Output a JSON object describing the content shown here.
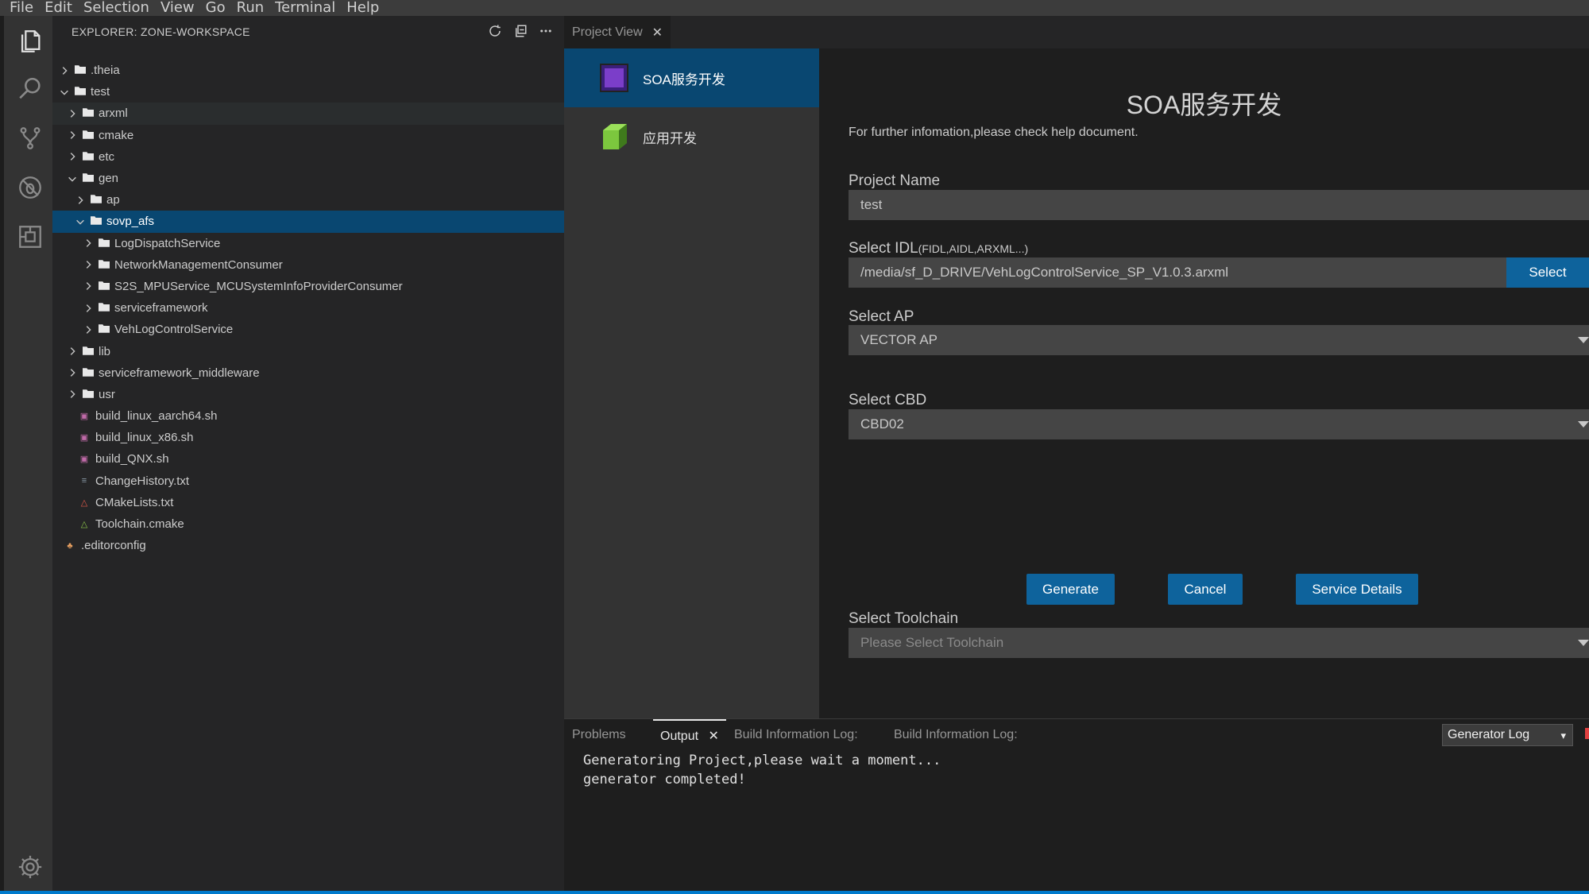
{
  "menu": [
    "File",
    "Edit",
    "Selection",
    "View",
    "Go",
    "Run",
    "Terminal",
    "Help"
  ],
  "activity_icons": [
    "files-icon",
    "search-icon",
    "source-control-icon",
    "debug-icon",
    "extensions-icon",
    "gear-icon"
  ],
  "explorer": {
    "title": "EXPLORER: ZONE-WORKSPACE",
    "tree": [
      {
        "label": ".theia",
        "depth": 0,
        "type": "folder",
        "expanded": false
      },
      {
        "label": "test",
        "depth": 0,
        "type": "folder",
        "expanded": true
      },
      {
        "label": "arxml",
        "depth": 1,
        "type": "folder",
        "expanded": false
      },
      {
        "label": "cmake",
        "depth": 1,
        "type": "folder",
        "expanded": false
      },
      {
        "label": "etc",
        "depth": 1,
        "type": "folder",
        "expanded": false
      },
      {
        "label": "gen",
        "depth": 1,
        "type": "folder",
        "expanded": true
      },
      {
        "label": "ap",
        "depth": 2,
        "type": "folder",
        "expanded": false
      },
      {
        "label": "sovp_afs",
        "depth": 2,
        "type": "folder",
        "expanded": true,
        "selected": true
      },
      {
        "label": "LogDispatchService",
        "depth": 3,
        "type": "folder",
        "expanded": false
      },
      {
        "label": "NetworkManagementConsumer",
        "depth": 3,
        "type": "folder",
        "expanded": false
      },
      {
        "label": "S2S_MPUService_MCUSystemInfoProviderConsumer",
        "depth": 3,
        "type": "folder",
        "expanded": false
      },
      {
        "label": "serviceframework",
        "depth": 3,
        "type": "folder",
        "expanded": false
      },
      {
        "label": "VehLogControlService",
        "depth": 3,
        "type": "folder",
        "expanded": false
      },
      {
        "label": "lib",
        "depth": 1,
        "type": "folder",
        "expanded": false
      },
      {
        "label": "serviceframework_middleware",
        "depth": 1,
        "type": "folder",
        "expanded": false
      },
      {
        "label": "usr",
        "depth": 1,
        "type": "folder",
        "expanded": false
      },
      {
        "label": "build_linux_aarch64.sh",
        "depth": 1,
        "type": "file",
        "icon": "shell-file-icon"
      },
      {
        "label": "build_linux_x86.sh",
        "depth": 1,
        "type": "file",
        "icon": "shell-file-icon"
      },
      {
        "label": "build_QNX.sh",
        "depth": 1,
        "type": "file",
        "icon": "shell-file-icon"
      },
      {
        "label": "ChangeHistory.txt",
        "depth": 1,
        "type": "file",
        "icon": "text-file-icon"
      },
      {
        "label": "CMakeLists.txt",
        "depth": 1,
        "type": "file",
        "icon": "cmake-file-icon"
      },
      {
        "label": "Toolchain.cmake",
        "depth": 1,
        "type": "file",
        "icon": "cmake-green-file-icon"
      },
      {
        "label": ".editorconfig",
        "depth": 0,
        "type": "file",
        "icon": "editorconfig-file-icon"
      }
    ]
  },
  "editor": {
    "tab_label": "Project View",
    "left_items": [
      {
        "label": "SOA服务开发",
        "active": true,
        "icon": "purple-cube-icon"
      },
      {
        "label": "应用开发",
        "active": false,
        "icon": "green-cube-icon"
      }
    ],
    "title": "SOA服务开发",
    "info": "For further infomation,please check help document.",
    "project_name_label": "Project Name",
    "project_name_value": "test",
    "idl_label": "Select IDL",
    "idl_hint": "(FIDL,AIDL,ARXML...)",
    "idl_value": "/media/sf_D_DRIVE/VehLogControlService_SP_V1.0.3.arxml",
    "idl_select_button": "Select",
    "ap_label": "Select AP",
    "ap_value": "VECTOR AP",
    "cbd_label": "Select CBD",
    "cbd_value": "CBD02",
    "buttons": {
      "generate": "Generate",
      "cancel": "Cancel",
      "details": "Service Details"
    },
    "toolchain_label": "Select Toolchain",
    "toolchain_placeholder": "Please Select Toolchain"
  },
  "panel": {
    "tabs": [
      "Problems",
      "Output",
      "Build Information Log:",
      "Build Information Log:"
    ],
    "active_tab": "Output",
    "log_select": "Generator Log",
    "output_lines": [
      "Generatoring Project,please wait a moment...",
      "generator completed!"
    ]
  },
  "colors": {
    "accent": "#0e639c",
    "selection": "#094771",
    "statusbar": "#007acc"
  }
}
